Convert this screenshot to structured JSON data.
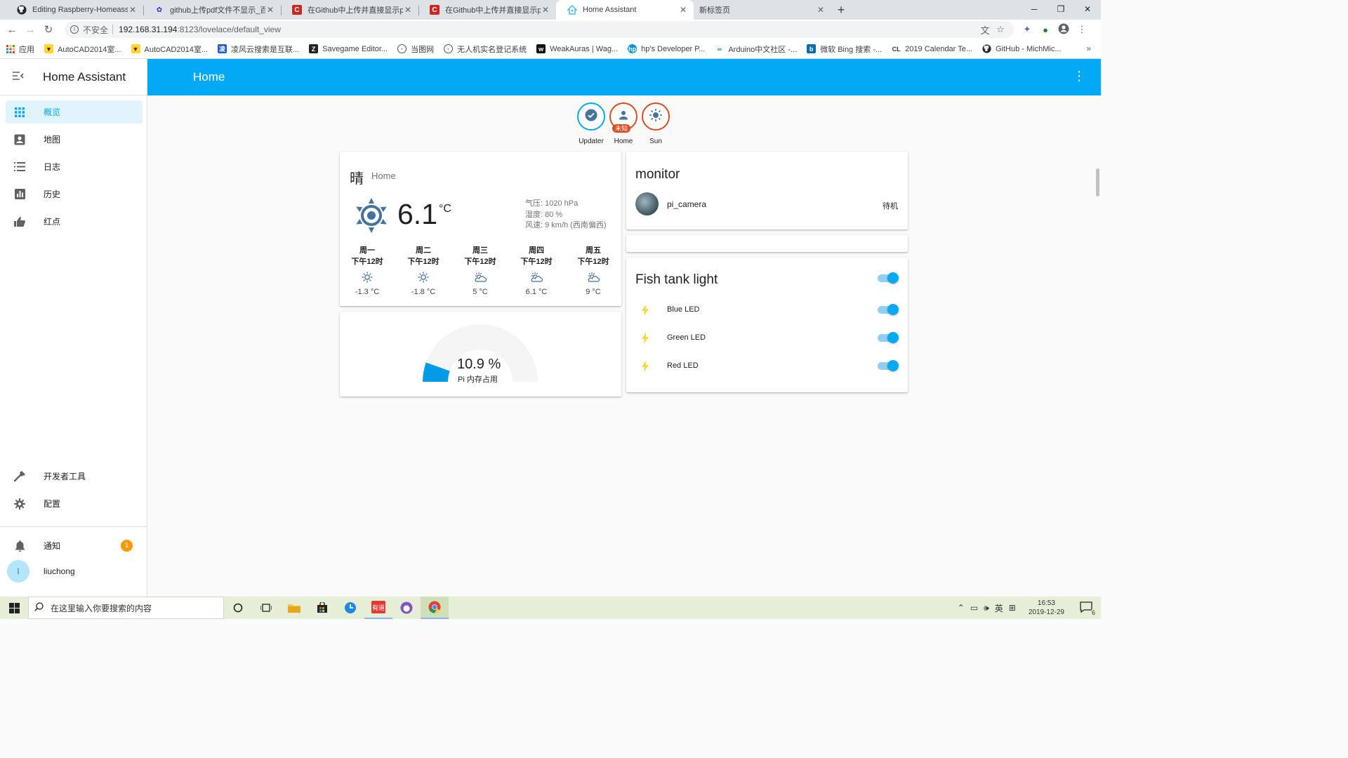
{
  "browser": {
    "tabs": [
      {
        "title": "Editing Raspberry-Homeassist",
        "icon": "github-icon",
        "color": "#24292e"
      },
      {
        "title": "github上传pdf文件不显示_百度",
        "icon": "baidu-paw-icon",
        "color": "#2932e1"
      },
      {
        "title": "在Github中上传并直接显示pdf文",
        "icon": "csdn-icon",
        "color": "#c9261d"
      },
      {
        "title": "在Github中上传并直接显示pdf文",
        "icon": "csdn-icon",
        "color": "#c9261d"
      },
      {
        "title": "Home Assistant",
        "icon": "home-assistant-icon",
        "color": "#41bdf5",
        "active": true
      },
      {
        "title": "新标签页",
        "icon": "",
        "color": ""
      }
    ],
    "address": {
      "security": "不安全",
      "host": "192.168.31.194",
      "rest": ":8123/lovelace/default_view"
    },
    "bookmarks": [
      {
        "label": "应用",
        "icon": "apps-grid-icon",
        "color": "#e53935"
      },
      {
        "label": "AutoCAD2014室...",
        "icon": "autocad-icon",
        "color": "#6d1c1c"
      },
      {
        "label": "AutoCAD2014室...",
        "icon": "autocad-icon",
        "color": "#6d1c1c"
      },
      {
        "label": "凌风云搜索是互联...",
        "icon": "lingfeng-icon",
        "color": "#1e5bd8"
      },
      {
        "label": "Savegame Editor...",
        "icon": "z-icon",
        "color": "#222222"
      },
      {
        "label": "当图网",
        "icon": "globe-icon",
        "color": "#555555"
      },
      {
        "label": "无人机实名登记系统",
        "icon": "globe-icon",
        "color": "#555555"
      },
      {
        "label": "WeakAuras | Wag...",
        "icon": "wago-icon",
        "color": "#111111"
      },
      {
        "label": "hp's Developer P...",
        "icon": "hp-icon",
        "color": "#0096d6"
      },
      {
        "label": "Arduino中文社区 -...",
        "icon": "arduino-icon",
        "color": "#00979c"
      },
      {
        "label": "微软 Bing 搜索 -...",
        "icon": "bing-icon",
        "color": "#0c6cb0"
      },
      {
        "label": "2019 Calendar Te...",
        "icon": "cl-icon",
        "color": "#333333"
      },
      {
        "label": "GitHub - MichMic...",
        "icon": "github-icon",
        "color": "#24292e"
      }
    ]
  },
  "sidebar": {
    "title": "Home Assistant",
    "items": [
      {
        "label": "概览",
        "icon": "apps-icon",
        "active": true
      },
      {
        "label": "地图",
        "icon": "account-box-icon"
      },
      {
        "label": "日志",
        "icon": "list-icon"
      },
      {
        "label": "历史",
        "icon": "chart-box-icon"
      },
      {
        "label": "红点",
        "icon": "thumb-icon"
      }
    ],
    "bottom": [
      {
        "label": "开发者工具",
        "icon": "hammer-icon"
      },
      {
        "label": "配置",
        "icon": "gear-icon"
      }
    ],
    "notifications": {
      "label": "通知",
      "count": "1"
    },
    "user": {
      "initial": "l",
      "name": "liuchong"
    }
  },
  "header": {
    "title": "Home"
  },
  "state_badges": [
    {
      "label": "Updater",
      "icon": "check-circle-icon",
      "tag": ""
    },
    {
      "label": "Home",
      "icon": "person-icon",
      "tag": "未知"
    },
    {
      "label": "Sun",
      "icon": "sun-icon",
      "tag": ""
    }
  ],
  "weather": {
    "condition": "晴",
    "location": "Home",
    "temperature": "6.1",
    "unit": "°C",
    "pressure": "气压: 1020 hPa",
    "humidity": "湿度: 80 %",
    "wind": "风速: 9 km/h (西南偏西)",
    "forecast": [
      {
        "day": "周一",
        "time": "下午12时",
        "icon": "sunny-icon",
        "temp": "-1.3 °C"
      },
      {
        "day": "周二",
        "time": "下午12时",
        "icon": "sunny-icon",
        "temp": "-1.8 °C"
      },
      {
        "day": "周三",
        "time": "下午12时",
        "icon": "partly-cloudy-icon",
        "temp": "5 °C"
      },
      {
        "day": "周四",
        "time": "下午12时",
        "icon": "partly-cloudy-icon",
        "temp": "6.1 °C"
      },
      {
        "day": "周五",
        "time": "下午12时",
        "icon": "partly-cloudy-icon",
        "temp": "9 °C"
      }
    ]
  },
  "gauge": {
    "value_text": "10.9 %",
    "value": 10.9,
    "max": 100,
    "name": "Pi 内存占用",
    "color": "#039be5"
  },
  "monitor": {
    "title": "monitor",
    "camera_name": "pi_camera",
    "camera_state": "待机"
  },
  "fish_tank": {
    "title": "Fish tank light",
    "master_on": true,
    "rows": [
      {
        "name": "Blue LED",
        "icon": "lightning-icon",
        "on": true
      },
      {
        "name": "Green LED",
        "icon": "lightning-icon",
        "on": true
      },
      {
        "name": "Red LED",
        "icon": "lightning-icon",
        "on": true
      }
    ]
  },
  "taskbar": {
    "search_placeholder": "在这里输入你要搜索的内容",
    "time": "16:53",
    "date": "2019-12-29",
    "ime": "英",
    "notifications_count": "6"
  }
}
